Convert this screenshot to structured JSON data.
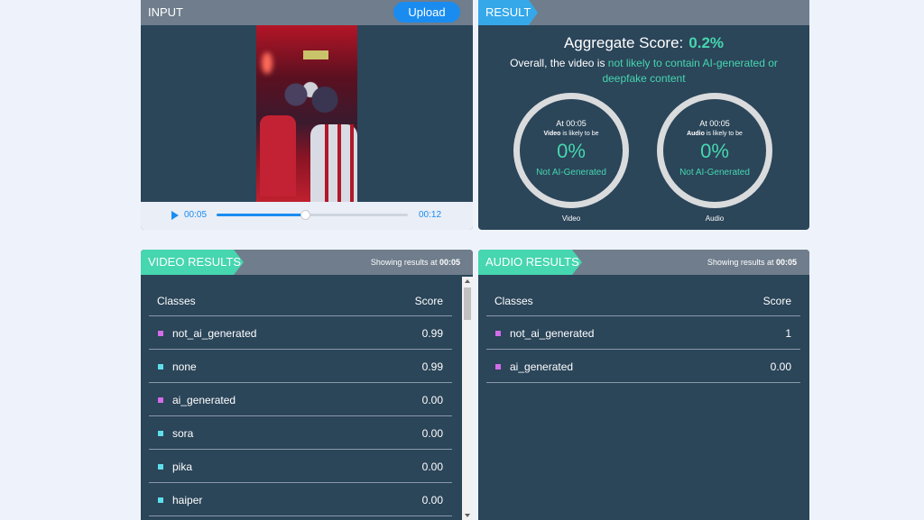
{
  "input": {
    "tag": "INPUT",
    "upload_label": "Upload"
  },
  "player": {
    "current_time": "00:05",
    "total_time": "00:12",
    "progress": 0.46
  },
  "result": {
    "tag": "RESULT",
    "aggregate_label": "Aggregate Score:",
    "aggregate_value": "0.2%",
    "overall_prefix": "Overall, the video is",
    "overall_verdict": "not likely to contain AI-generated or deepfake content",
    "gauges": [
      {
        "at": "At 00:05",
        "subject": "Video",
        "likely_text": "is likely to be",
        "percent": "0%",
        "label": "Not AI-Generated",
        "name": "Video"
      },
      {
        "at": "At 00:05",
        "subject": "Audio",
        "likely_text": "is likely to be",
        "percent": "0%",
        "label": "Not AI-Generated",
        "name": "Audio"
      }
    ]
  },
  "video_results": {
    "tag": "VIDEO RESULTS",
    "showing_prefix": "Showing results at",
    "showing_time": "00:05",
    "header": {
      "classes": "Classes",
      "score": "Score"
    },
    "rows": [
      {
        "class": "not_ai_generated",
        "score": "0.99",
        "color": "#d36ce9"
      },
      {
        "class": "none",
        "score": "0.99",
        "color": "#5ee0ec"
      },
      {
        "class": "ai_generated",
        "score": "0.00",
        "color": "#d36ce9"
      },
      {
        "class": "sora",
        "score": "0.00",
        "color": "#5ee0ec"
      },
      {
        "class": "pika",
        "score": "0.00",
        "color": "#5ee0ec"
      },
      {
        "class": "haiper",
        "score": "0.00",
        "color": "#5ee0ec"
      }
    ]
  },
  "audio_results": {
    "tag": "AUDIO RESULTS",
    "showing_prefix": "Showing results at",
    "showing_time": "00:05",
    "header": {
      "classes": "Classes",
      "score": "Score"
    },
    "rows": [
      {
        "class": "not_ai_generated",
        "score": "1",
        "color": "#d36ce9"
      },
      {
        "class": "ai_generated",
        "score": "0.00",
        "color": "#d36ce9"
      }
    ]
  },
  "colors": {
    "accent": "#46d6b0",
    "input_tag": "#6f7d8c",
    "result_tag": "#35a8ea",
    "results_tag": "#46d6b0",
    "panel_bg": "#2b4559",
    "primary": "#1a8cf0"
  }
}
